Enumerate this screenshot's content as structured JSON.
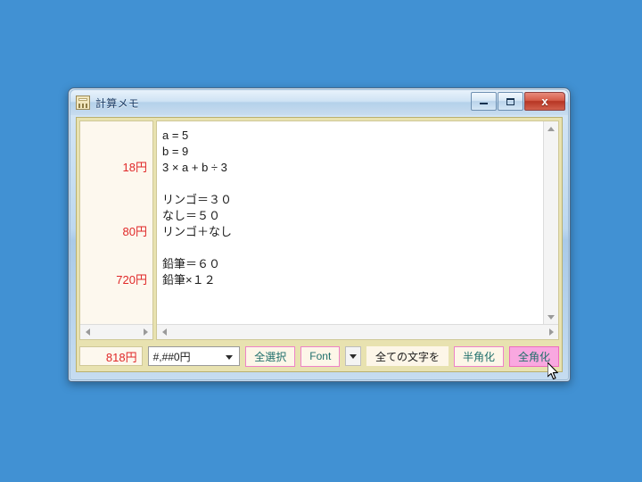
{
  "desktop": {
    "background_color": "#4191d3"
  },
  "window": {
    "title": "計算メモ",
    "icon": "calculator-icon",
    "buttons": {
      "minimize": "minimize-icon",
      "maximize": "maximize-icon",
      "close": "x"
    }
  },
  "editor": {
    "results": [
      {
        "value": ""
      },
      {
        "value": ""
      },
      {
        "value": "18円"
      },
      {
        "value": ""
      },
      {
        "value": ""
      },
      {
        "value": ""
      },
      {
        "value": "80円"
      },
      {
        "value": ""
      },
      {
        "value": ""
      },
      {
        "value": "720円"
      }
    ],
    "lines": [
      "a = 5",
      "b = 9",
      "3 × a + b ÷ 3",
      "",
      "リンゴ＝３０",
      "なし＝５０",
      "リンゴ＋なし",
      "",
      "鉛筆＝６０",
      "鉛筆×１２"
    ]
  },
  "toolbar": {
    "total": "818円",
    "format_selected": "#,##0円",
    "select_all_label": "全選択",
    "font_label": "Font",
    "all_chars_label": "全ての文字を",
    "half_width_label": "半角化",
    "full_width_label": "全角化"
  },
  "colors": {
    "result_text": "#e02828",
    "button_border": "#ef82c8",
    "button_text": "#1f6f6b",
    "button_hover_fill": "#f9a8e0",
    "panel_background": "#e8e2b0",
    "result_pane_background": "#fdf8ee"
  }
}
